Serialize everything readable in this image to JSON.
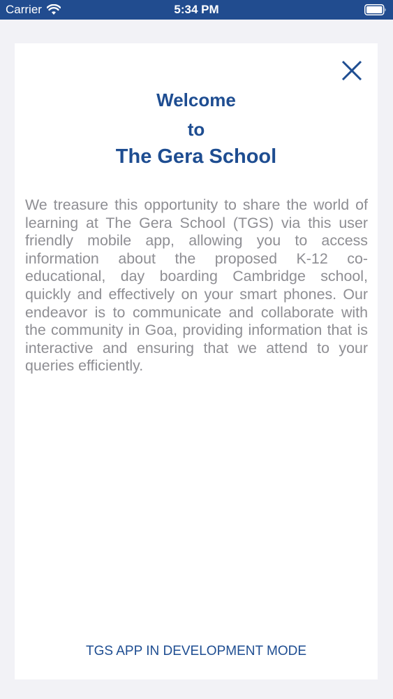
{
  "status_bar": {
    "carrier": "Carrier",
    "time": "5:34 PM",
    "wifi_icon": "wifi-icon",
    "battery_icon": "battery-icon"
  },
  "colors": {
    "status_bar": "#214c8f",
    "brand_blue": "#1e4d91",
    "body_text": "#8e8e93",
    "background": "#f2f2f6",
    "card": "#ffffff"
  },
  "welcome": {
    "close_icon": "close-icon",
    "title_line1": "Welcome",
    "title_line2": "to",
    "title_line3": "The Gera School",
    "body": "We treasure this opportunity to share the world of learning at The Gera School (TGS) via this user friendly mobile app, allowing you to access information about the proposed K-12 co-educational, day boarding Cambridge school, quickly and effectively on your smart phones. Our endeavor is to communicate and collaborate with the community in Goa, providing information that is interactive and ensuring that we attend to your queries efficiently.",
    "footer": "TGS APP IN DEVELOPMENT MODE"
  }
}
